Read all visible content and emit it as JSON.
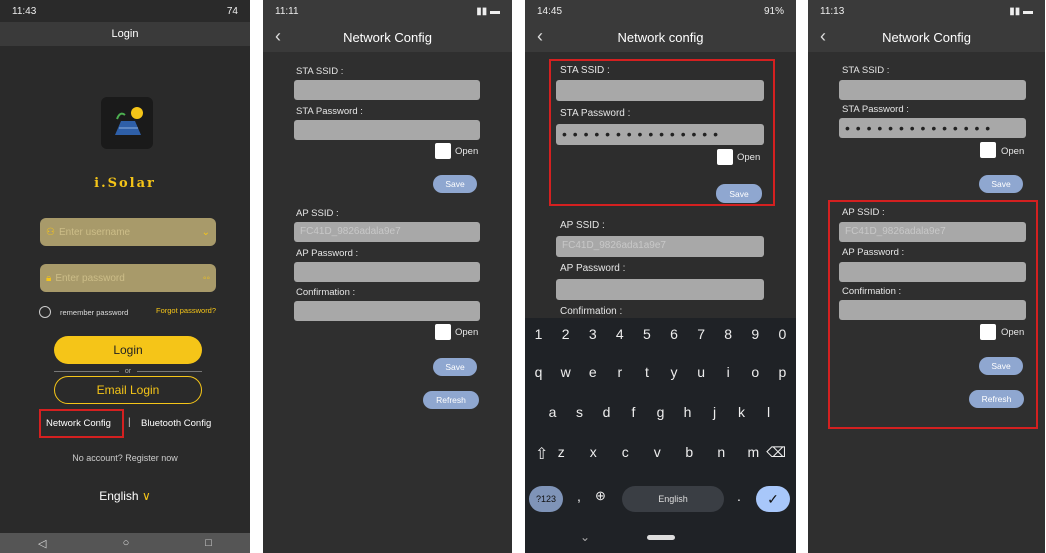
{
  "phone1": {
    "status_time": "11:43",
    "status_right": "74",
    "title": "Login",
    "brand": "i.Solar",
    "username_placeholder": "Enter username",
    "password_placeholder": "Enter password",
    "remember": "remember password",
    "forgot": "Forgot password?",
    "login_btn": "Login",
    "or": "or",
    "email_btn": "Email Login",
    "network_config": "Network Config",
    "sep": "|",
    "bluetooth_config": "Bluetooth Config",
    "register": "No account? Register now",
    "language": "English"
  },
  "phone2": {
    "status_time": "11:11",
    "title": "Network Config",
    "sta_ssid": "STA SSID :",
    "sta_password": "STA Password :",
    "open": "Open",
    "save": "Save",
    "ap_ssid": "AP SSID :",
    "ap_ssid_value": "FC41D_9826adala9e7",
    "ap_password": "AP Password :",
    "confirmation": "Confirmation :",
    "open2": "Open",
    "save2": "Save",
    "refresh": "Refresh"
  },
  "phone3": {
    "status_time": "14:45",
    "status_right": "91%",
    "title": "Network config",
    "sta_ssid": "STA SSID :",
    "sta_password": "STA Password :",
    "sta_password_dots": "• • • • • • • • • • • • • • •",
    "open": "Open",
    "save": "Save",
    "ap_ssid": "AP SSID :",
    "ap_ssid_value": "FC41D_9826ada1a9e7",
    "ap_password": "AP Password :",
    "confirmation": "Confirmation :",
    "kb_row1": [
      "1",
      "2",
      "3",
      "4",
      "5",
      "6",
      "7",
      "8",
      "9",
      "0"
    ],
    "kb_row2": [
      "q",
      "w",
      "e",
      "r",
      "t",
      "y",
      "u",
      "i",
      "o",
      "p"
    ],
    "kb_row3": [
      "a",
      "s",
      "d",
      "f",
      "g",
      "h",
      "j",
      "k",
      "l"
    ],
    "kb_row4": [
      "z",
      "x",
      "c",
      "v",
      "b",
      "n",
      "m"
    ],
    "kb_123": "?123",
    "kb_comma": ",",
    "kb_space": "English",
    "kb_period": "."
  },
  "phone4": {
    "status_time": "11:13",
    "title": "Network Config",
    "sta_ssid": "STA SSID :",
    "sta_password": "STA Password :",
    "sta_password_dots": "• • • • • • • • • • • • • •",
    "open": "Open",
    "save": "Save",
    "ap_ssid": "AP SSID :",
    "ap_ssid_value": "FC41D_9826adala9e7",
    "ap_password": "AP Password :",
    "confirmation": "Confirmation :",
    "open2": "Open",
    "save2": "Save",
    "refresh": "Refresh"
  },
  "colors": {
    "accent": "#f5c518",
    "highlight": "#d42020",
    "pill": "#8fa7d0"
  }
}
